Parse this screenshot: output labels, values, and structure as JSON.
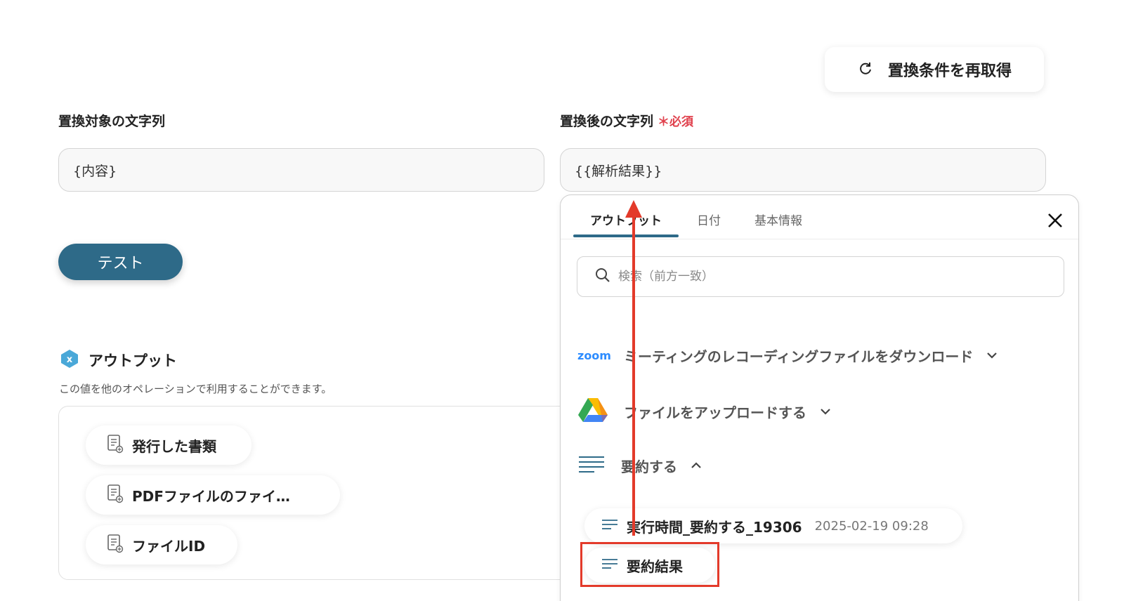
{
  "refresh_button": {
    "label": "置換条件を再取得",
    "icon": "refresh-icon"
  },
  "fields": {
    "target": {
      "label": "置換対象の文字列",
      "value": "{内容}"
    },
    "replacement": {
      "label": "置換後の文字列",
      "required": "＊必須",
      "value": "{{解析結果}}"
    }
  },
  "test_button": {
    "label": "テスト"
  },
  "output": {
    "title": "アウトプット",
    "description": "この値を他のオペレーションで利用することができます。",
    "items": [
      {
        "label": "発行した書類",
        "icon": "document-icon"
      },
      {
        "label": "PDFファイルのファイ…",
        "icon": "document-icon"
      },
      {
        "label": "ファイルID",
        "icon": "document-icon"
      }
    ]
  },
  "panel": {
    "tabs": [
      {
        "label": "アウトプット",
        "active": true
      },
      {
        "label": "日付",
        "active": false
      },
      {
        "label": "基本情報",
        "active": false
      }
    ],
    "search_placeholder": "検索（前方一致）",
    "groups": [
      {
        "label": "ミーティングのレコーディングファイルをダウンロード",
        "icon": "zoom-logo",
        "logo_text": "zoom",
        "expanded": false
      },
      {
        "label": "ファイルをアップロードする",
        "icon": "google-drive-icon",
        "expanded": false
      },
      {
        "label": "要約する",
        "icon": "lines-icon",
        "expanded": true
      }
    ],
    "items": [
      {
        "label": "実行時間_要約する_19306",
        "timestamp": "2025-02-19 09:28"
      },
      {
        "label": "要約結果",
        "timestamp": ""
      }
    ]
  },
  "colors": {
    "accent": "#2e6a88",
    "required": "#e0404c",
    "annotation": "#e33a2a",
    "zoom": "#2d8cff"
  }
}
